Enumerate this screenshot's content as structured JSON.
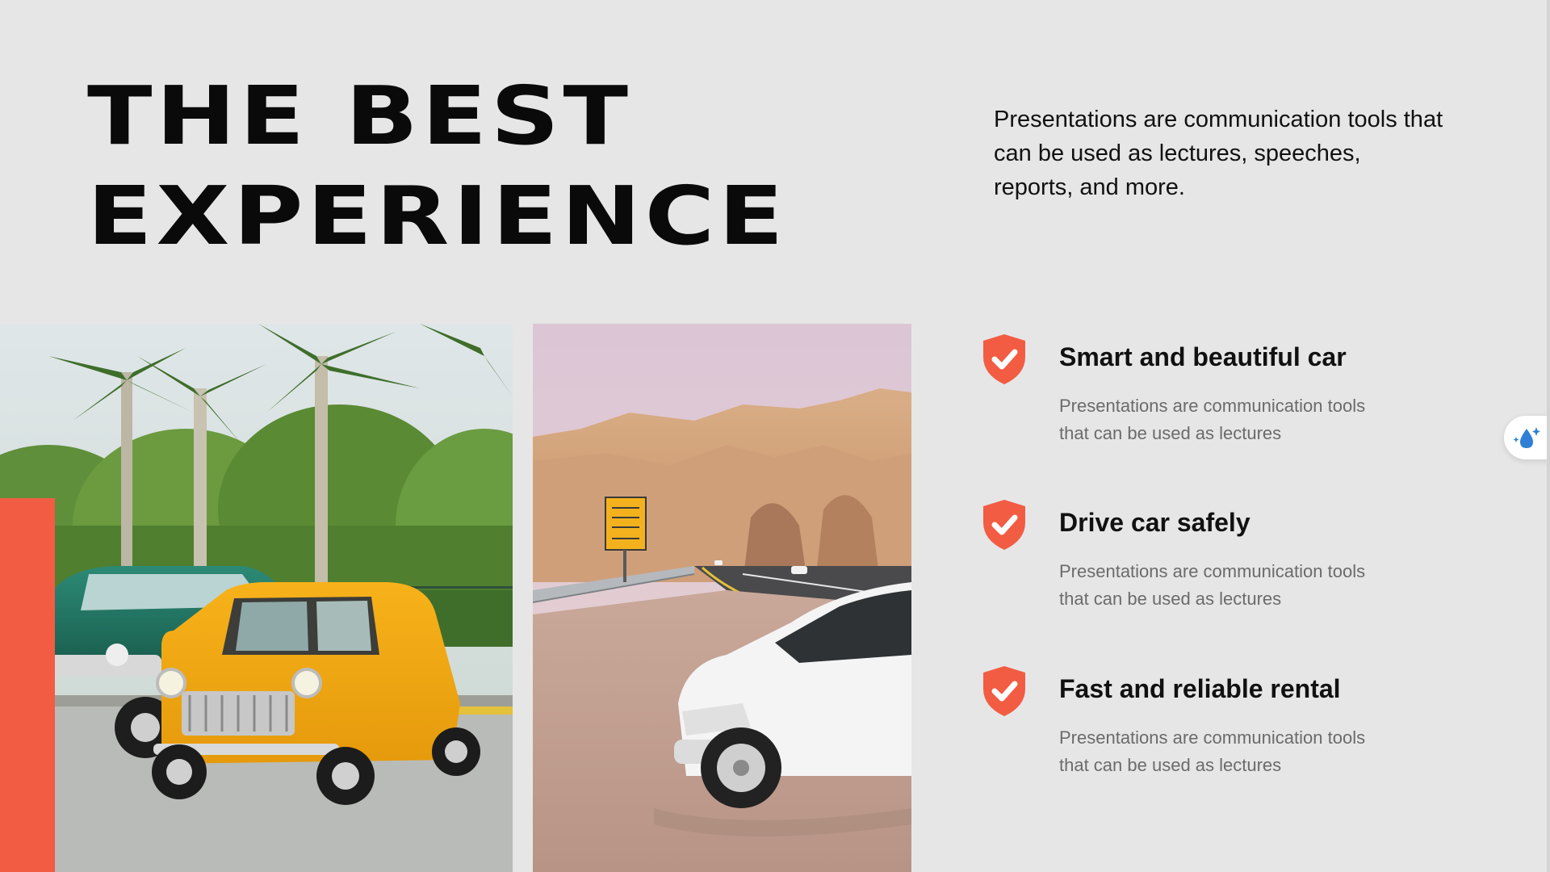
{
  "slide": {
    "title_line1": "THE BEST",
    "title_line2": "EXPERIENCE",
    "intro_text": "Presentations are communication tools that can be used as lectures, speeches, reports, and more."
  },
  "features": [
    {
      "title": "Smart and beautiful car",
      "description": "Presentations are communication tools that can be used as lectures",
      "icon": "shield-check-icon"
    },
    {
      "title": "Drive car safely",
      "description": "Presentations are communication tools that can be used as lectures",
      "icon": "shield-check-icon"
    },
    {
      "title": "Fast and reliable rental",
      "description": "Presentations are communication tools that can be used as lectures",
      "icon": "shield-check-icon"
    }
  ],
  "images": {
    "left_photo": "classic-cars-photo",
    "right_photo": "desert-road-photo"
  },
  "widget": {
    "icon": "water-drop-sparkle-icon"
  },
  "colors": {
    "accent": "#f25c43",
    "background": "#e6e6e6",
    "title": "#0a0a0a",
    "description": "#6b6b6b"
  }
}
